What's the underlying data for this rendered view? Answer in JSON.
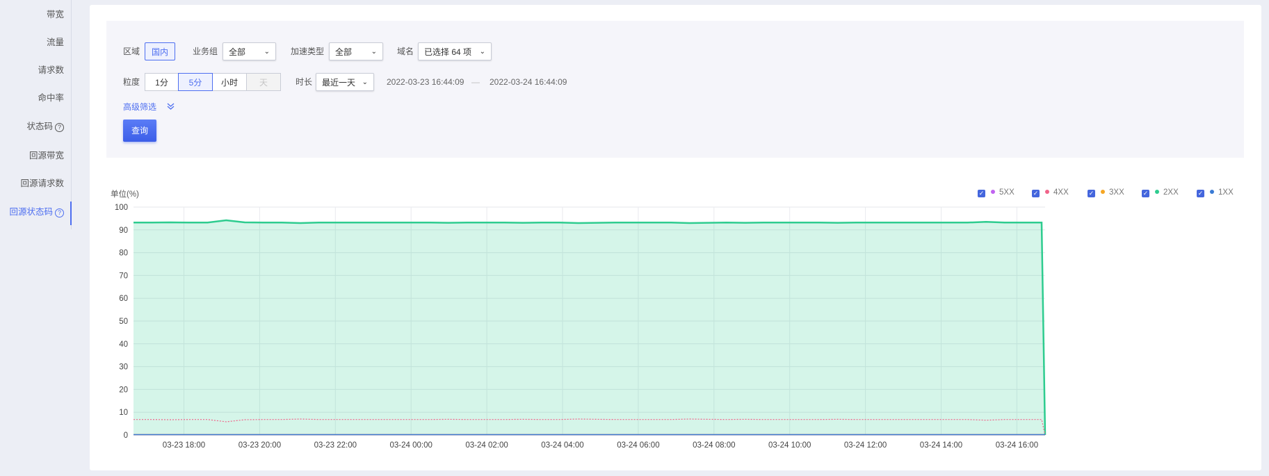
{
  "sidebar": {
    "items": [
      {
        "label": "带宽",
        "help": false,
        "active": false
      },
      {
        "label": "流量",
        "help": false,
        "active": false
      },
      {
        "label": "请求数",
        "help": false,
        "active": false
      },
      {
        "label": "命中率",
        "help": false,
        "active": false
      },
      {
        "label": "状态码",
        "help": true,
        "active": false
      },
      {
        "label": "回源带宽",
        "help": false,
        "active": false
      },
      {
        "label": "回源请求数",
        "help": false,
        "active": false
      },
      {
        "label": "回源状态码",
        "help": true,
        "active": true
      }
    ],
    "help_glyph": "?"
  },
  "filter": {
    "region_label": "区域",
    "region_value": "国内",
    "biz_group_label": "业务组",
    "biz_group_value": "全部",
    "accel_type_label": "加速类型",
    "accel_type_value": "全部",
    "domain_label": "域名",
    "domain_value": "已选择 64 项",
    "granularity_label": "粒度",
    "granularity_options": [
      "1分",
      "5分",
      "小时",
      "天"
    ],
    "granularity_selected": "5分",
    "granularity_disabled": "天",
    "duration_label": "时长",
    "duration_value": "最近一天",
    "time_start": "2022-03-23 16:44:09",
    "time_sep": "—",
    "time_end": "2022-03-24 16:44:09",
    "advanced_label": "高级筛选",
    "advanced_icon": "double-chevron-down-icon",
    "query_button": "查询",
    "chevron_glyph": "⌄"
  },
  "chart_data": {
    "type": "area",
    "ylabel": "单位(%)",
    "ylim": [
      0,
      100
    ],
    "y_ticks": [
      0,
      10,
      20,
      30,
      40,
      50,
      60,
      70,
      80,
      90,
      100
    ],
    "x_tick_labels": [
      "03-23 18:00",
      "03-23 20:00",
      "03-23 22:00",
      "03-24 00:00",
      "03-24 02:00",
      "03-24 04:00",
      "03-24 06:00",
      "03-24 08:00",
      "03-24 10:00",
      "03-24 12:00",
      "03-24 14:00",
      "03-24 16:00"
    ],
    "x_range": [
      "2022-03-23 16:45",
      "2022-03-24 16:45"
    ],
    "grid": true,
    "legend_position": "top-right",
    "series": [
      {
        "name": "5XX",
        "color": "#c063f0",
        "values": [
          0,
          0
        ]
      },
      {
        "name": "4XX",
        "color": "#f0648a",
        "approx_value": 6.8,
        "values": [
          6.8,
          6.8,
          6.7,
          6.8,
          6.8,
          5.8,
          6.7,
          6.8,
          6.8,
          7.0,
          6.8,
          6.8,
          6.8,
          6.8,
          6.8,
          6.8,
          6.8,
          6.9,
          6.8,
          6.8,
          6.8,
          6.9,
          6.8,
          6.8,
          7.0,
          6.9,
          6.8,
          6.8,
          6.8,
          6.8,
          7.0,
          6.9,
          6.8,
          6.9,
          6.8,
          6.8,
          6.8,
          6.8,
          6.9,
          6.8,
          6.8,
          6.8,
          6.8,
          6.8,
          6.8,
          6.8,
          6.5,
          6.8,
          6.8,
          6.8,
          0
        ]
      },
      {
        "name": "3XX",
        "color": "#f5a623",
        "values": [
          0,
          0
        ]
      },
      {
        "name": "2XX",
        "color": "#2ecc8f",
        "approx_value": 93.2,
        "values": [
          93.2,
          93.2,
          93.3,
          93.2,
          93.2,
          94.2,
          93.3,
          93.2,
          93.2,
          93.0,
          93.2,
          93.2,
          93.2,
          93.2,
          93.2,
          93.2,
          93.2,
          93.1,
          93.2,
          93.2,
          93.2,
          93.1,
          93.2,
          93.2,
          93.0,
          93.1,
          93.2,
          93.2,
          93.2,
          93.2,
          93.0,
          93.1,
          93.2,
          93.1,
          93.2,
          93.2,
          93.2,
          93.2,
          93.1,
          93.2,
          93.2,
          93.2,
          93.2,
          93.2,
          93.2,
          93.2,
          93.5,
          93.2,
          93.2,
          93.2,
          0
        ]
      },
      {
        "name": "1XX",
        "color": "#3a7bd5",
        "values": [
          0,
          0
        ]
      }
    ]
  },
  "legend_checkbox_glyph": "✓"
}
